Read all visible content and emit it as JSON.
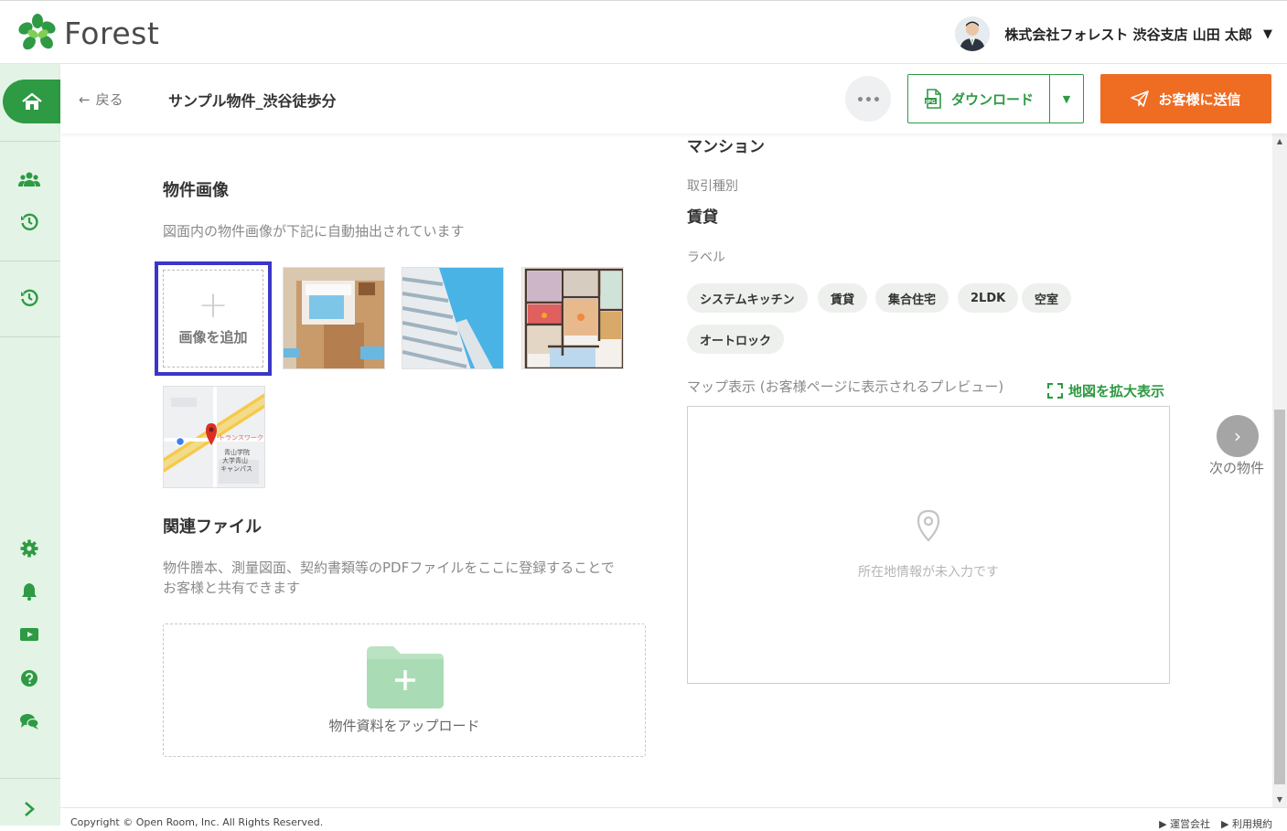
{
  "app": {
    "logo_text": "Forest",
    "brand_color": "#2e9a43",
    "accent_color": "#ef6c23"
  },
  "user": {
    "name": "株式会社フォレスト 渋谷支店 山田 太郎",
    "caret": "▼"
  },
  "sidebar": {
    "items": [
      {
        "icon": "home-icon"
      },
      {
        "icon": "customers-icon"
      },
      {
        "icon": "history-icon"
      },
      {
        "icon": "history-icon"
      },
      {
        "icon": "settings-icon"
      },
      {
        "icon": "bell-icon"
      },
      {
        "icon": "video-icon"
      },
      {
        "icon": "help-icon"
      },
      {
        "icon": "chat-icon"
      },
      {
        "icon": "expand-icon"
      }
    ]
  },
  "subheader": {
    "back_label": "戻る",
    "title": "サンプル物件_渋谷徒歩分",
    "download_label": "ダウンロード",
    "download_badge": "JPG",
    "send_label": "お客様に送信"
  },
  "images_section": {
    "heading": "物件画像",
    "hint": "図面内の物件画像が下記に自動抽出されています",
    "add_label": "画像を追加",
    "add_plus": "+",
    "map_thumb_text": [
      "トランスワーク",
      "青山学院",
      "大学青山",
      "キャンパス"
    ]
  },
  "files_section": {
    "heading": "関連ファイル",
    "hint_line1": "物件謄本、測量図面、契約書類等のPDFファイルをここに登録することで",
    "hint_line2": "お客様と共有できます",
    "upload_label": "物件資料をアップロード"
  },
  "details": {
    "building_type": "マンション",
    "transaction_label": "取引種別",
    "transaction_value": "賃貸",
    "labels_label": "ラベル",
    "tags": [
      "システムキッチン",
      "賃貸",
      "集合住宅",
      "2LDK",
      "空室",
      "オートロック"
    ]
  },
  "map": {
    "label": "マップ表示 (お客様ページに表示されるプレビュー)",
    "expand_label": "地図を拡大表示",
    "empty_text": "所在地情報が未入力です"
  },
  "next": {
    "label": "次の物件",
    "arrow": "›"
  },
  "footer": {
    "copyright": "Copyright © Open Room, Inc. All Rights Reserved.",
    "links": [
      "▶ 運営会社",
      "▶ 利用規約"
    ]
  }
}
